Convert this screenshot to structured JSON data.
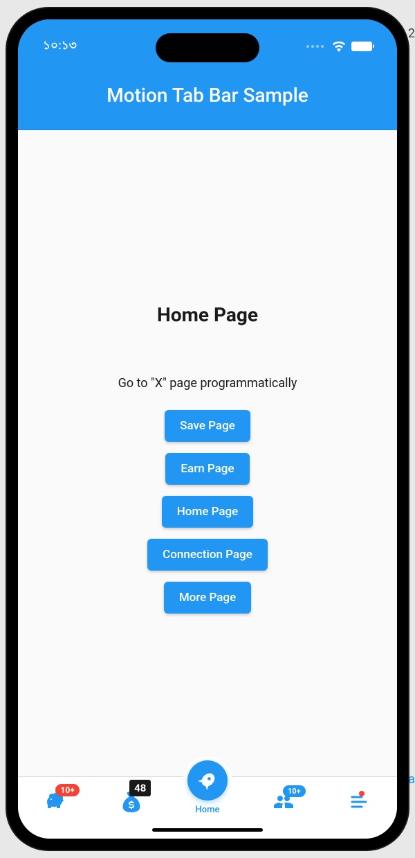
{
  "status_bar": {
    "time": "১০:১৩"
  },
  "app_bar": {
    "title": "Motion Tab Bar Sample"
  },
  "content": {
    "page_title": "Home Page",
    "subtitle": "Go to \"X\" page programmatically",
    "buttons": [
      "Save Page",
      "Earn Page",
      "Home Page",
      "Connection Page",
      "More Page"
    ]
  },
  "tab_bar": {
    "items": [
      {
        "name": "save",
        "badge": "10+",
        "badge_type": "red"
      },
      {
        "name": "earn",
        "badge": "48",
        "badge_type": "black"
      },
      {
        "name": "home",
        "label": "Home",
        "active": true
      },
      {
        "name": "connection",
        "badge": "10+",
        "badge_type": "blue"
      },
      {
        "name": "more",
        "badge_type": "dot"
      }
    ]
  },
  "edge": {
    "a": "2",
    "b": "a"
  }
}
